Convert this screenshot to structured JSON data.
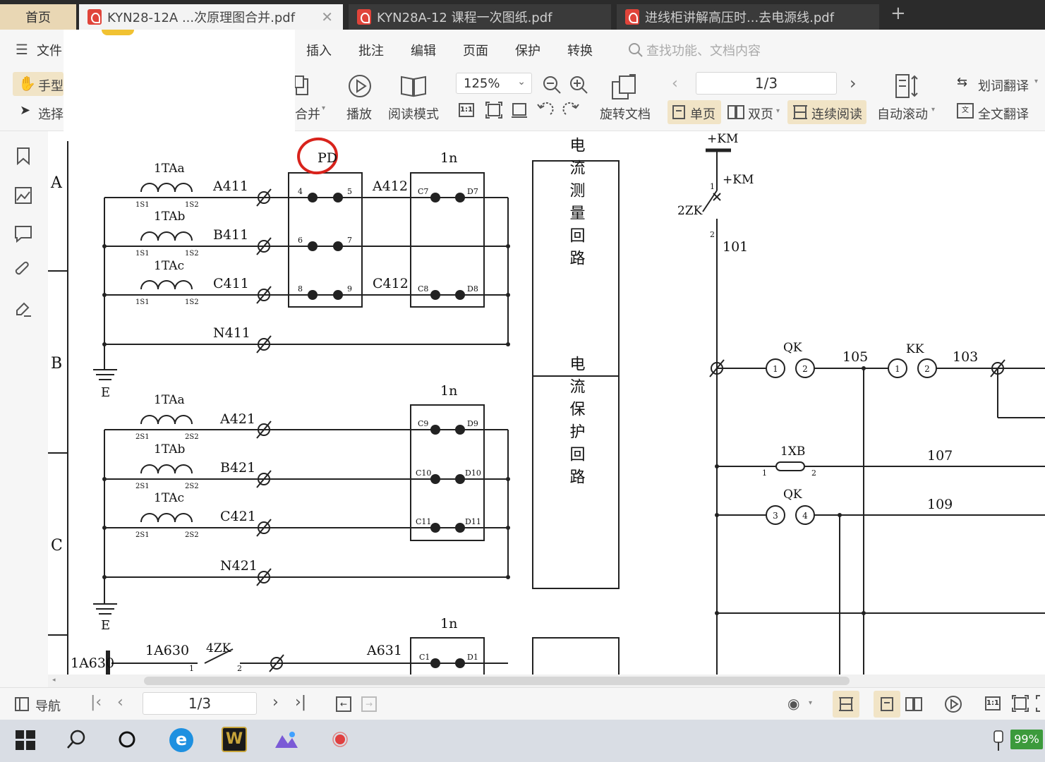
{
  "tabs": {
    "home": "首页",
    "tab1": "KYN28-12A ...次原理图合并.pdf",
    "tab2": "KYN28A-12 课程一次图纸.pdf",
    "tab3": "进线柜讲解高压时...去电源线.pdf",
    "new_tab": "+"
  },
  "menu": {
    "file": "文件",
    "insert": "插入",
    "annotate": "批注",
    "edit": "编辑",
    "page": "页面",
    "protect": "保护",
    "convert": "转换",
    "search_placeholder": "查找功能、文档内容"
  },
  "toolbar": {
    "hand": "手型",
    "select": "选择",
    "merge": "合并",
    "play": "播放",
    "read_mode": "阅读模式",
    "zoom": "125%",
    "rotate": "旋转文档",
    "page_indicator": "1/3",
    "single": "单页",
    "double": "双页",
    "continuous": "连续阅读",
    "auto_scroll": "自动滚动",
    "word_translate": "划词翻译",
    "full_translate": "全文翻译",
    "actual_size": "1:1"
  },
  "schematic": {
    "zone_a": "A",
    "zone_b": "B",
    "zone_c": "C",
    "pd": "PD",
    "n1": "1n",
    "n2": "1n",
    "n3": "1n",
    "ct_a1": "1TAa",
    "ct_b1": "1TAb",
    "ct_c1": "1TAc",
    "ct_a2": "1TAa",
    "ct_b2": "1TAb",
    "ct_c2": "1TAc",
    "s1_1": "1S1",
    "s2_1": "1S2",
    "s1_2": "1S1",
    "s2_2": "1S2",
    "s1_3": "1S1",
    "s2_3": "1S2",
    "s1_4": "2S1",
    "s2_4": "2S2",
    "s1_5": "2S1",
    "s2_5": "2S2",
    "s1_6": "2S1",
    "s2_6": "2S2",
    "a411": "A411",
    "b411": "B411",
    "c411": "C411",
    "n411": "N411",
    "a412": "A412",
    "c412": "C412",
    "a421": "A421",
    "b421": "B421",
    "c421": "C421",
    "n421": "N421",
    "t4": "4",
    "t5": "5",
    "t6": "6",
    "t7": "7",
    "t8": "8",
    "t9": "9",
    "c7": "C7",
    "d7": "D7",
    "c8": "C8",
    "d8": "D8",
    "c9": "C9",
    "d9": "D9",
    "c10": "C10",
    "d10": "D10",
    "c11": "C11",
    "d11": "D11",
    "c1": "C1",
    "d1": "D1",
    "e1": "E",
    "e2": "E",
    "box1": "电流测量回路",
    "box2": "电流保护回路",
    "a1630": "1A630",
    "a1630b": "1A630",
    "zk4": "4ZK",
    "a631": "A631",
    "p1": "1",
    "p2": "2",
    "km": "+KM",
    "km2": "+KM",
    "zk2": "2ZK",
    "k1": "1",
    "k2": "2",
    "w101": "101",
    "qk": "QK",
    "kk": "KK",
    "w105": "105",
    "w103": "103",
    "qk1": "1",
    "qk2": "2",
    "kk1": "1",
    "kk2": "2",
    "xb": "1XB",
    "xb1": "1",
    "xb2": "2",
    "w107": "107",
    "qk_b": "QK",
    "qk3": "3",
    "qk4": "4",
    "w109": "109"
  },
  "status": {
    "nav": "导航",
    "page": "1/3"
  },
  "taskbar": {
    "battery": "99%"
  }
}
